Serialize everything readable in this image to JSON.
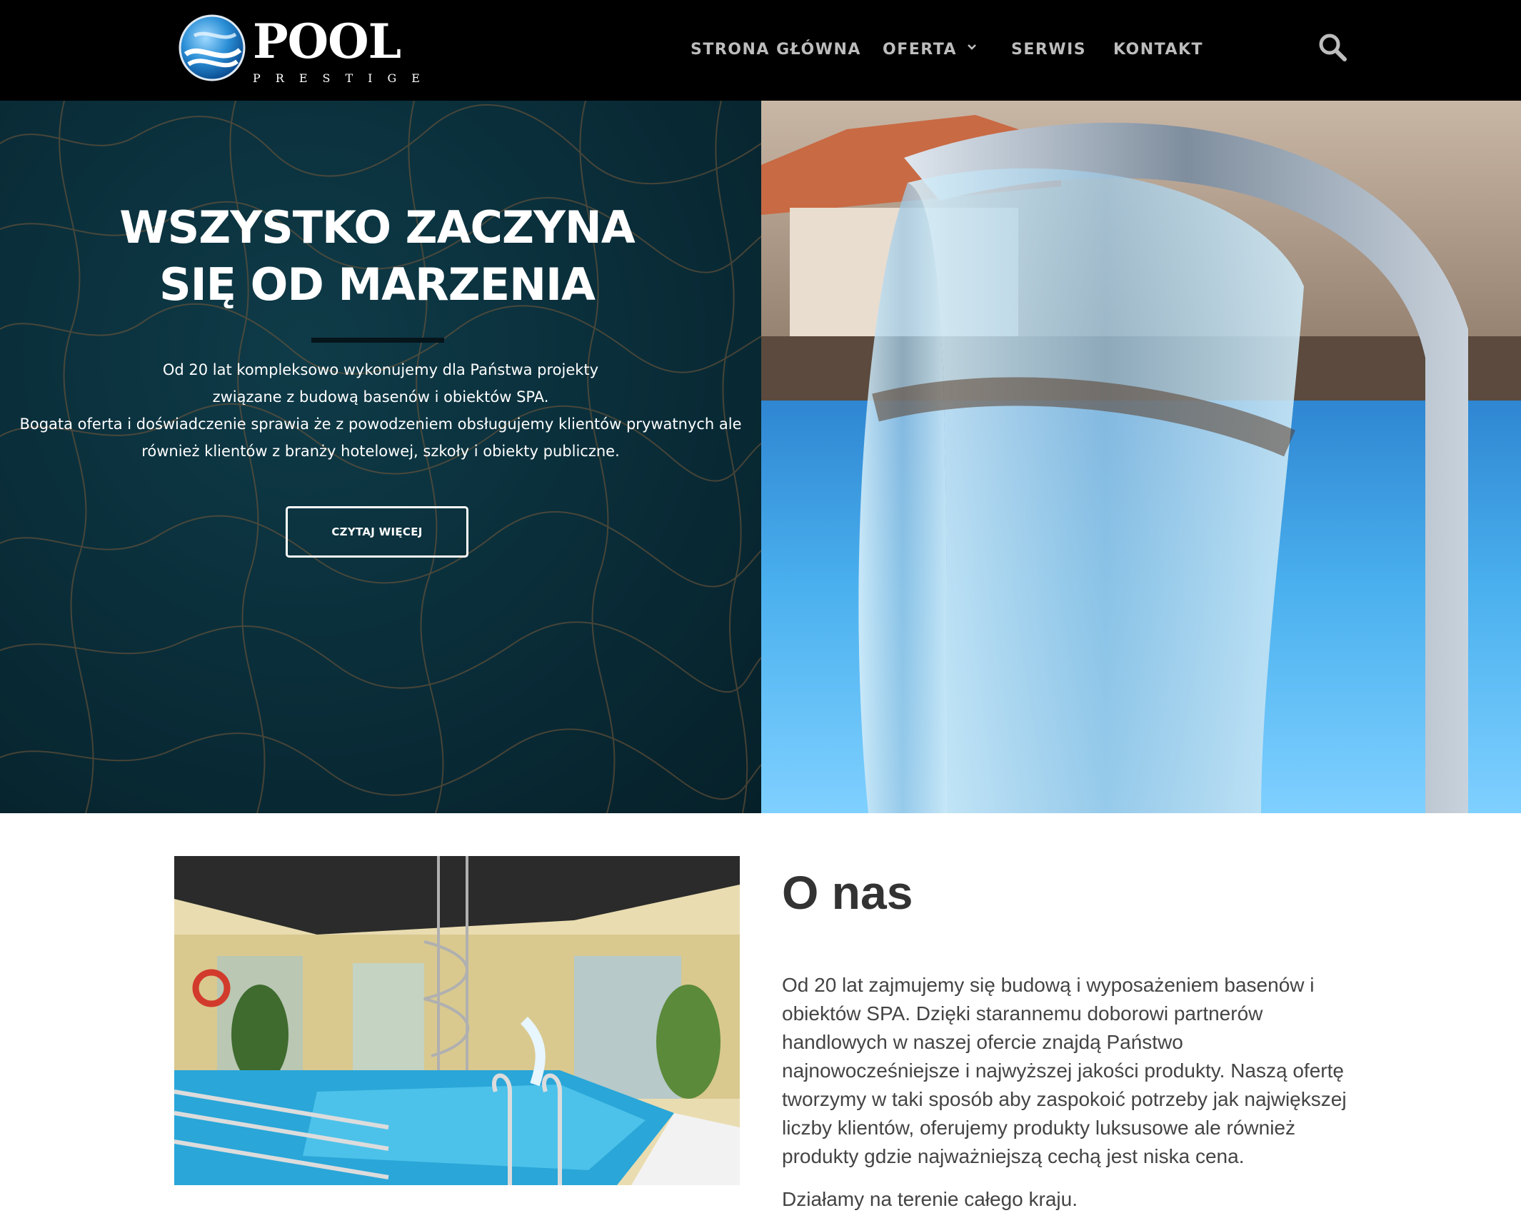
{
  "brand": {
    "name": "POOL",
    "tagline": "PRESTIGE"
  },
  "nav": {
    "items": [
      {
        "label": "STRONA GŁÓWNA",
        "icon": ""
      },
      {
        "label": "OFERTA",
        "icon": "chevron-down-icon"
      },
      {
        "label": "SERWIS",
        "icon": ""
      },
      {
        "label": "KONTAKT",
        "icon": ""
      }
    ],
    "search_icon": "search-icon"
  },
  "hero": {
    "title_lines": [
      "WSZYSTKO ZACZYNA",
      "SIĘ OD MARZENIA"
    ],
    "text_lines": [
      "Od 20 lat kompleksowo wykonujemy dla Państwa projekty",
      "związane z budową basenów i obiektów SPA.",
      "Bogata oferta i doświadczenie sprawia że z powodzeniem obsługujemy klientów prywatnych ale",
      "również klientów z branży hotelowej, szkoły i obiekty publiczne."
    ],
    "button_label": "CZYTAJ WIĘCEJ"
  },
  "about": {
    "title": "O nas",
    "paragraph_lines": [
      "Od 20 lat zajmujemy się budową i wyposażeniem basenów i",
      "obiektów SPA. Dzięki starannemu doborowi partnerów",
      "handlowych w naszej ofercie znajdą Państwo",
      "najnowocześniejsze i najwyższej jakości produkty. Naszą ofertę",
      "tworzymy w taki sposób aby zaspokoić potrzeby jak największej",
      "liczby klientów, oferujemy produkty luksusowe ale również",
      "produkty gdzie najważniejszą cechą jest niska cena."
    ],
    "paragraph2": "Działamy na terenie całego kraju."
  },
  "colors": {
    "header_bg": "#000000",
    "nav_text": "#bdbdbd",
    "hero_left_bg": "#0a2f3b",
    "pool_blue": "#3fa7e6",
    "body_text": "#444444"
  }
}
